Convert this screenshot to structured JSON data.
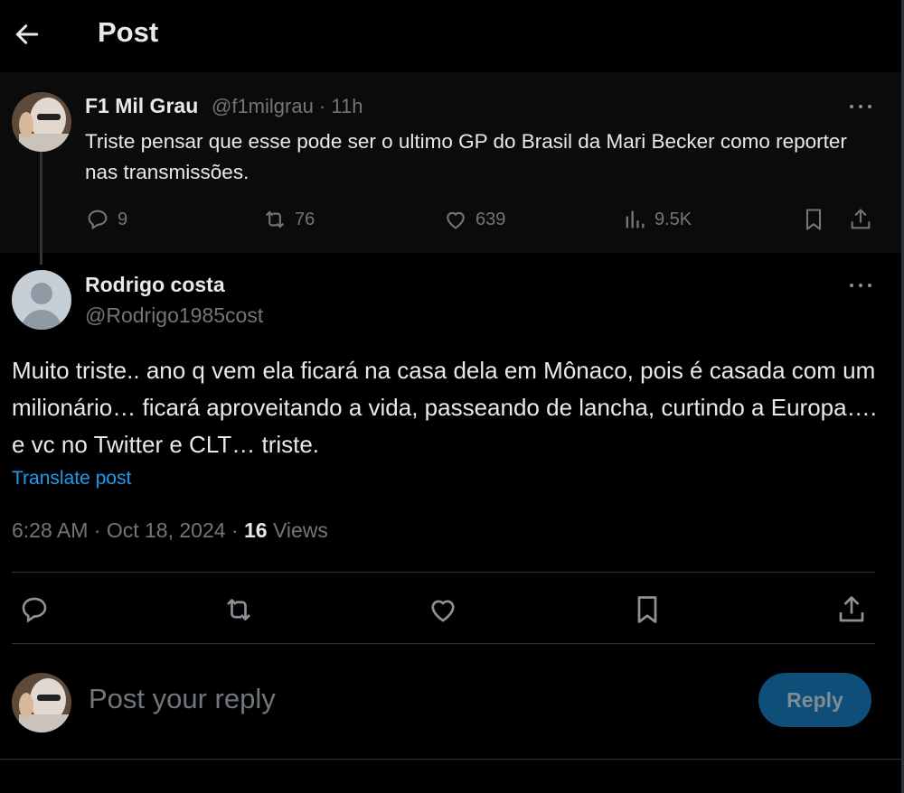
{
  "header": {
    "title": "Post"
  },
  "parent_post": {
    "name": "F1 Mil Grau",
    "handle_time": "@f1milgrau · 11h",
    "text": "Triste pensar que esse pode ser o ultimo GP do Brasil da Mari Becker como reporter nas transmissões.",
    "stats": {
      "replies": "9",
      "reposts": "76",
      "likes": "639",
      "views": "9.5K"
    }
  },
  "reply_post": {
    "name": "Rodrigo costa",
    "handle": "@Rodrigo1985cost",
    "text": "Muito triste..  ano q vem ela ficará na casa dela em Mônaco, pois é casada com um milionário… ficará aproveitando a vida, passeando de lancha, curtindo a Europa…. e vc no Twitter e CLT… triste.",
    "translate_label": "Translate post",
    "timestamp": "6:28 AM · Oct 18, 2024 · ",
    "views_count": "16",
    "views_label": " Views"
  },
  "composer": {
    "placeholder": "Post your reply",
    "button_label": "Reply"
  },
  "colors": {
    "accent": "#1d9bf0",
    "reply_button": "#0f4e78",
    "muted": "#71767b"
  }
}
